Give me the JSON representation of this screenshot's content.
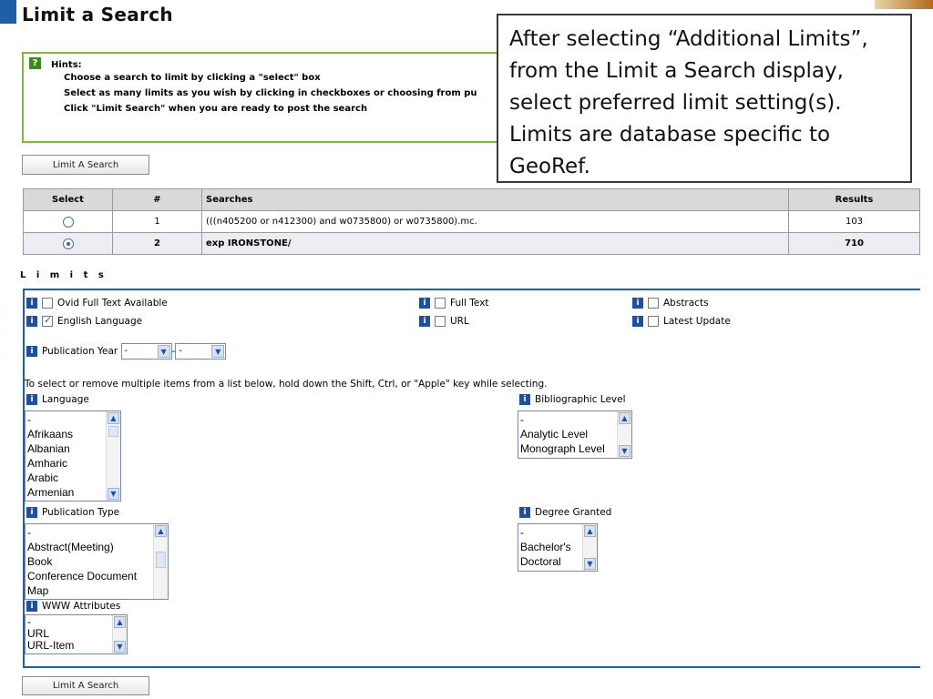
{
  "page": {
    "title": "Limit a Search"
  },
  "hints": {
    "label": "Hints:",
    "items": [
      "Choose a search to limit by clicking a \"select\" box",
      "Select as many limits as you wish by clicking in checkboxes or choosing from pu",
      "Click \"Limit Search\" when you are ready to post the search"
    ]
  },
  "callout": {
    "text": "After selecting “Additional Limits”, from the Limit a Search display, select preferred limit setting(s). Limits are database specific to GeoRef."
  },
  "buttons": {
    "limit_search": "Limit A Search"
  },
  "searches": {
    "headers": [
      "Select",
      "#",
      "Searches",
      "Results"
    ],
    "rows": [
      {
        "num": "1",
        "query": "(((n405200 or n412300) and w0735800) or w0735800).mc.",
        "results": "103",
        "selected": false
      },
      {
        "num": "2",
        "query": "exp IRONSTONE/",
        "results": "710",
        "selected": true
      }
    ]
  },
  "limits": {
    "heading": "L i m i t s",
    "checkboxes": {
      "ovid_full_text": {
        "label": "Ovid Full Text Available",
        "checked": false
      },
      "full_text": {
        "label": "Full Text",
        "checked": false
      },
      "abstracts": {
        "label": "Abstracts",
        "checked": false
      },
      "english_language": {
        "label": "English Language",
        "checked": true
      },
      "url": {
        "label": "URL",
        "checked": false
      },
      "latest_update": {
        "label": "Latest Update",
        "checked": false
      }
    },
    "pub_year": {
      "label": "Publication Year",
      "from": "-",
      "sep": "-",
      "to": "-"
    },
    "instruction": "To select or remove multiple items from a list below, hold down the Shift, Ctrl, or \"Apple\" key while selecting.",
    "language": {
      "label": "Language",
      "options": [
        "-",
        "Afrikaans",
        "Albanian",
        "Amharic",
        "Arabic",
        "Armenian"
      ]
    },
    "bib_level": {
      "label": "Bibliographic Level",
      "options": [
        "-",
        "Analytic Level",
        "Monograph Level"
      ]
    },
    "pub_type": {
      "label": "Publication Type",
      "options": [
        "-",
        "Abstract(Meeting)",
        "Book",
        "Conference Document",
        "Map"
      ]
    },
    "degree": {
      "label": "Degree Granted",
      "options": [
        "-",
        "Bachelor's",
        "Doctoral"
      ]
    },
    "www": {
      "label": "WWW Attributes",
      "options": [
        "-",
        "URL",
        "URL-Item"
      ]
    }
  },
  "colors": {
    "accent_blue": "#1f5fa8",
    "hint_green": "#7fbb3a",
    "check_green": "#2a7a2a"
  }
}
